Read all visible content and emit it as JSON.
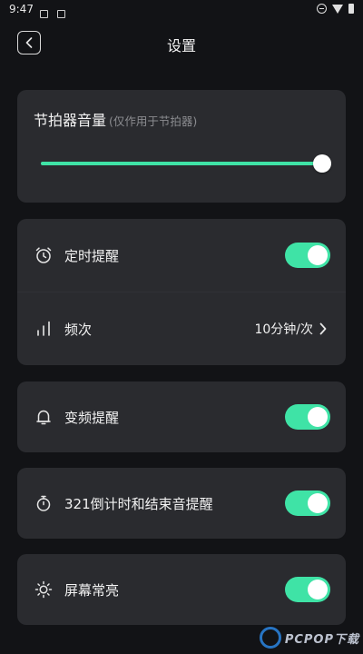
{
  "status_bar": {
    "time": "9:47"
  },
  "header": {
    "title": "设置"
  },
  "volume": {
    "title": "节拍器音量",
    "subtitle": "(仅作用于节拍器)",
    "level": 0.97
  },
  "settings": {
    "timer_reminder": {
      "label": "定时提醒",
      "enabled": true
    },
    "frequency": {
      "label": "频次",
      "value": "10分钟/次"
    },
    "tempo_change_reminder": {
      "label": "变频提醒",
      "enabled": true
    },
    "countdown_reminder": {
      "label": "321倒计时和结束音提醒",
      "enabled": true
    },
    "screen_always_on": {
      "label": "屏幕常亮",
      "enabled": true
    }
  },
  "watermark": {
    "text": "PCPOP下载"
  },
  "colors": {
    "accent": "#3fe3a6",
    "card": "#2a2b2f",
    "background": "#121316"
  }
}
